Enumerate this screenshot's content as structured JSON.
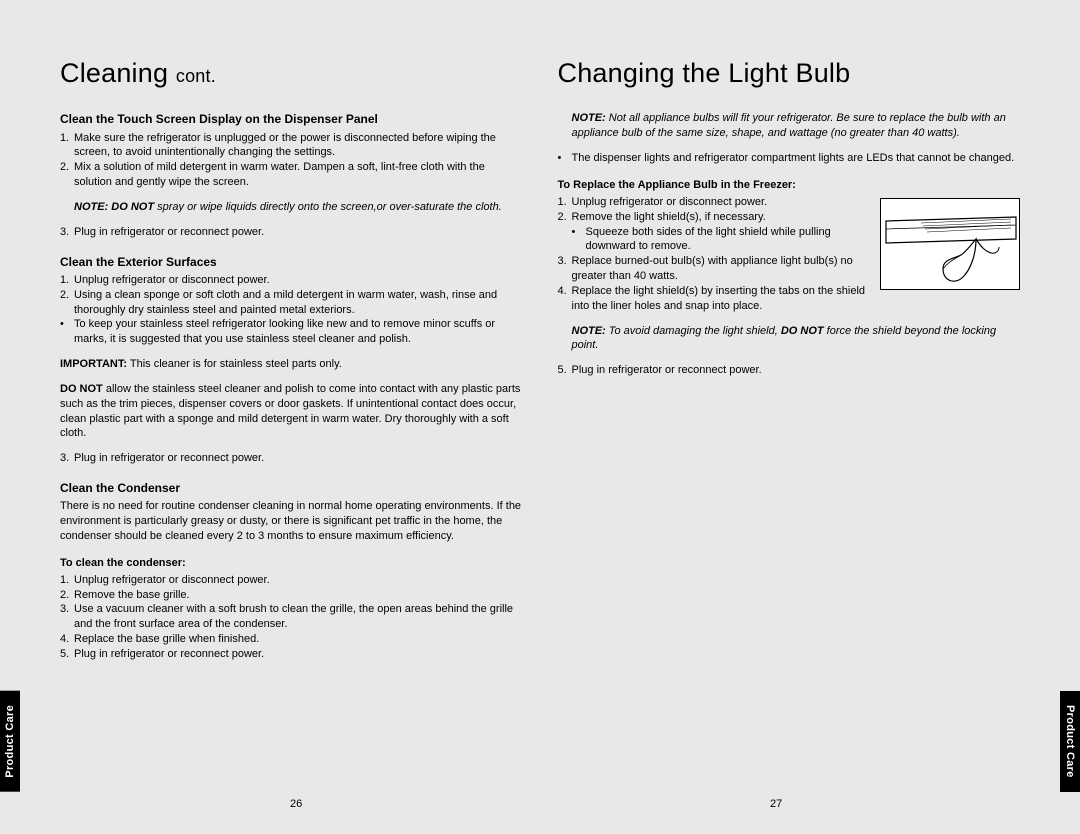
{
  "sideTab": "Product Care",
  "pageNumbers": {
    "left": "26",
    "right": "27"
  },
  "left": {
    "heading": "Cleaning",
    "headingSuffix": "cont.",
    "sec1": {
      "title": "Clean the Touch Screen Display on the Dispenser Panel",
      "i1": "Make sure the refrigerator is unplugged or the power is disconnected before wiping the screen, to avoid unintentionally changing the settings.",
      "i2": "Mix a solution of mild detergent in warm water. Dampen a soft, lint-free cloth with the solution and gently wipe the screen.",
      "noteLabel": "NOTE: DO NOT",
      "noteBody": " spray or wipe liquids directly onto the screen,or over-saturate the cloth.",
      "i3": "Plug in refrigerator or reconnect power."
    },
    "sec2": {
      "title": "Clean the Exterior Surfaces",
      "i1": "Unplug refrigerator or disconnect power.",
      "i2": "Using a clean sponge or soft cloth and a mild detergent in warm water, wash, rinse and thoroughly dry stainless steel and painted metal exteriors.",
      "b1": "To keep your stainless steel refrigerator looking like new and to remove minor scuffs or marks, it is suggested that you use stainless steel cleaner and polish.",
      "importantLabel": "IMPORTANT:",
      "importantBody": " This cleaner is for stainless steel parts only.",
      "doNotLabel": "DO NOT",
      "doNotBody": " allow the stainless steel cleaner and polish to come into contact with any plastic parts such as the trim pieces, dispenser covers or door gaskets. If unintentional contact does occur, clean plastic part with a sponge and mild detergent in warm water. Dry thoroughly with a soft cloth.",
      "i3": "Plug in refrigerator or reconnect power."
    },
    "sec3": {
      "title": "Clean the Condenser",
      "intro": "There is no need for routine condenser cleaning in normal home operating environments. If the environment is particularly greasy or dusty, or there is significant pet traffic in the home, the condenser should be cleaned every 2 to 3 months to ensure maximum efficiency.",
      "sub": "To clean the condenser:",
      "i1": "Unplug refrigerator or disconnect power.",
      "i2": "Remove the base grille.",
      "i3": "Use a vacuum cleaner with a soft brush to clean the grille, the open areas behind the grille and the front surface area of the condenser.",
      "i4": "Replace the base grille when finished.",
      "i5": "Plug in refrigerator or reconnect power."
    }
  },
  "right": {
    "heading": "Changing the Light Bulb",
    "noteLabel": "NOTE:",
    "noteBody": " Not all appliance bulbs will fit your refrigerator. Be sure to replace the bulb with an appliance bulb of the same size, shape, and wattage (no greater than 40 watts).",
    "b1": "The dispenser lights and refrigerator compartment lights are LEDs that cannot be changed.",
    "sub": "To Replace the Appliance Bulb in the Freezer:",
    "i1": "Unplug refrigerator or disconnect power.",
    "i2": "Remove the light shield(s), if necessary.",
    "i2sub": "Squeeze both sides of the light shield while pulling downward to remove.",
    "i3": "Replace burned-out bulb(s) with appliance light bulb(s) no greater than 40 watts.",
    "i4": "Replace the light shield(s) by inserting the tabs on the shield into the liner holes and snap into place.",
    "note2Label": "NOTE:",
    "note2Body1": " To avoid damaging the light shield, ",
    "note2DoNot": "DO NOT",
    "note2Body2": " force the shield beyond the locking point.",
    "i5": "Plug in refrigerator or reconnect power."
  }
}
